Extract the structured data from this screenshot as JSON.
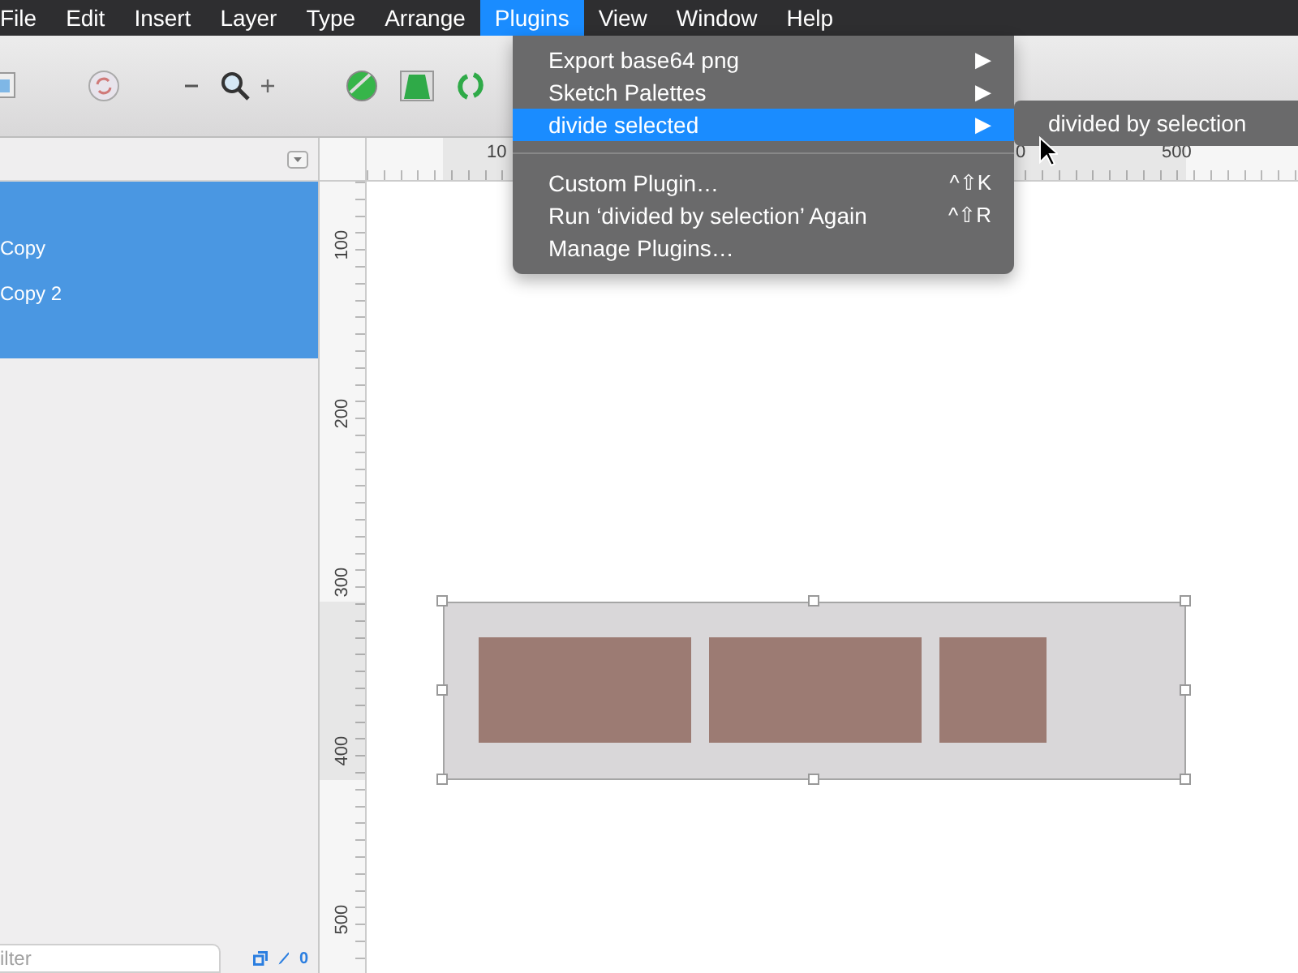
{
  "menu_bar": {
    "items": [
      {
        "label": "File",
        "selected": false
      },
      {
        "label": "Edit",
        "selected": false
      },
      {
        "label": "Insert",
        "selected": false
      },
      {
        "label": "Layer",
        "selected": false
      },
      {
        "label": "Type",
        "selected": false
      },
      {
        "label": "Arrange",
        "selected": false
      },
      {
        "label": "Plugins",
        "selected": true
      },
      {
        "label": "View",
        "selected": false
      },
      {
        "label": "Window",
        "selected": false
      },
      {
        "label": "Help",
        "selected": false
      }
    ]
  },
  "plugins_menu": {
    "items": [
      {
        "kind": "item",
        "label": "Export base64 png",
        "arrow": "▶",
        "selected": false
      },
      {
        "kind": "item",
        "label": "Sketch Palettes",
        "arrow": "▶",
        "selected": false
      },
      {
        "kind": "item",
        "label": "divide selected",
        "arrow": "▶",
        "selected": true
      },
      {
        "kind": "separator"
      },
      {
        "kind": "item",
        "label": "Custom Plugin…",
        "shortcut": "^⇧K",
        "selected": false
      },
      {
        "kind": "item",
        "label": "Run ‘divided by selection’ Again",
        "shortcut": "^⇧R",
        "selected": false
      },
      {
        "kind": "item",
        "label": "Manage Plugins…",
        "selected": false
      }
    ]
  },
  "submenu": {
    "items": [
      {
        "label": "divided by selection",
        "selected": false
      }
    ]
  },
  "sidebar": {
    "layers": [
      {
        "name": "Copy",
        "selected": true
      },
      {
        "name": "Copy 2",
        "selected": true
      }
    ],
    "filter": {
      "placeholder": "ilter"
    },
    "count": "0"
  },
  "rulers": {
    "top_labels": [
      "10",
      "0",
      "500"
    ],
    "left_labels": [
      "100",
      "200",
      "300",
      "400",
      "500"
    ]
  }
}
